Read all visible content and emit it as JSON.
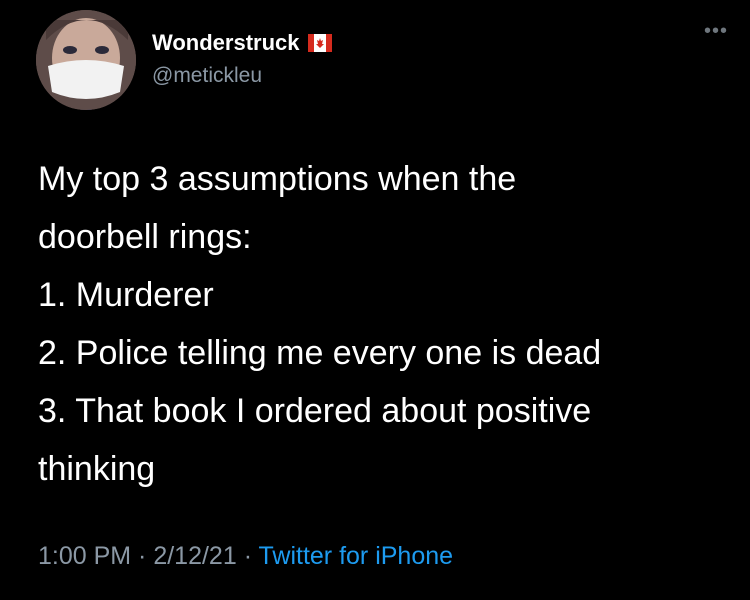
{
  "tweet": {
    "author": {
      "display_name": "Wonderstruck",
      "handle": "@metickleu",
      "flag_icon": "canada-flag-icon"
    },
    "more_icon": "more-options-icon",
    "text_lines": [
      "My top 3 assumptions when the",
      "doorbell rings:",
      "1. Murderer",
      "2. Police telling me every one is dead",
      "3. That book I ordered about positive",
      "thinking"
    ],
    "meta": {
      "time": "1:00 PM",
      "separator": " · ",
      "date": "2/12/21",
      "source": "Twitter for iPhone"
    }
  },
  "colors": {
    "background": "#000000",
    "text": "#ffffff",
    "secondary": "#8b98a5",
    "link": "#1d9bf0",
    "flag_red": "#d52b1e"
  }
}
